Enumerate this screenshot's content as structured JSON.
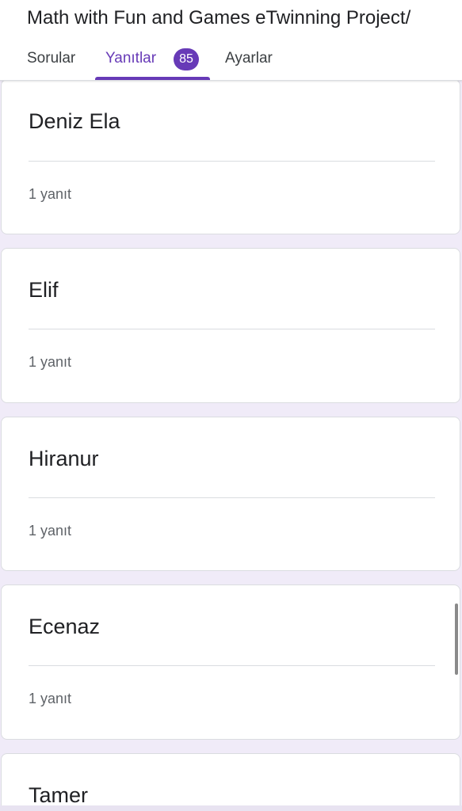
{
  "app": {
    "title": "Math with Fun and Games eTwinning Project/"
  },
  "tabs": [
    {
      "label": "Sorular"
    },
    {
      "label": "Yanıtlar",
      "badge": "85",
      "active": true
    },
    {
      "label": "Ayarlar"
    }
  ],
  "responses": [
    {
      "name": "Deniz Ela",
      "count": "1 yanıt"
    },
    {
      "name": "Elif",
      "count": "1 yanıt"
    },
    {
      "name": "Hiranur",
      "count": "1 yanıt"
    },
    {
      "name": "Ecenaz",
      "count": "1 yanıt"
    },
    {
      "name": "Tamer",
      "count": ""
    }
  ],
  "colors": {
    "accent": "#673ab7",
    "background": "#f0ebf8"
  }
}
